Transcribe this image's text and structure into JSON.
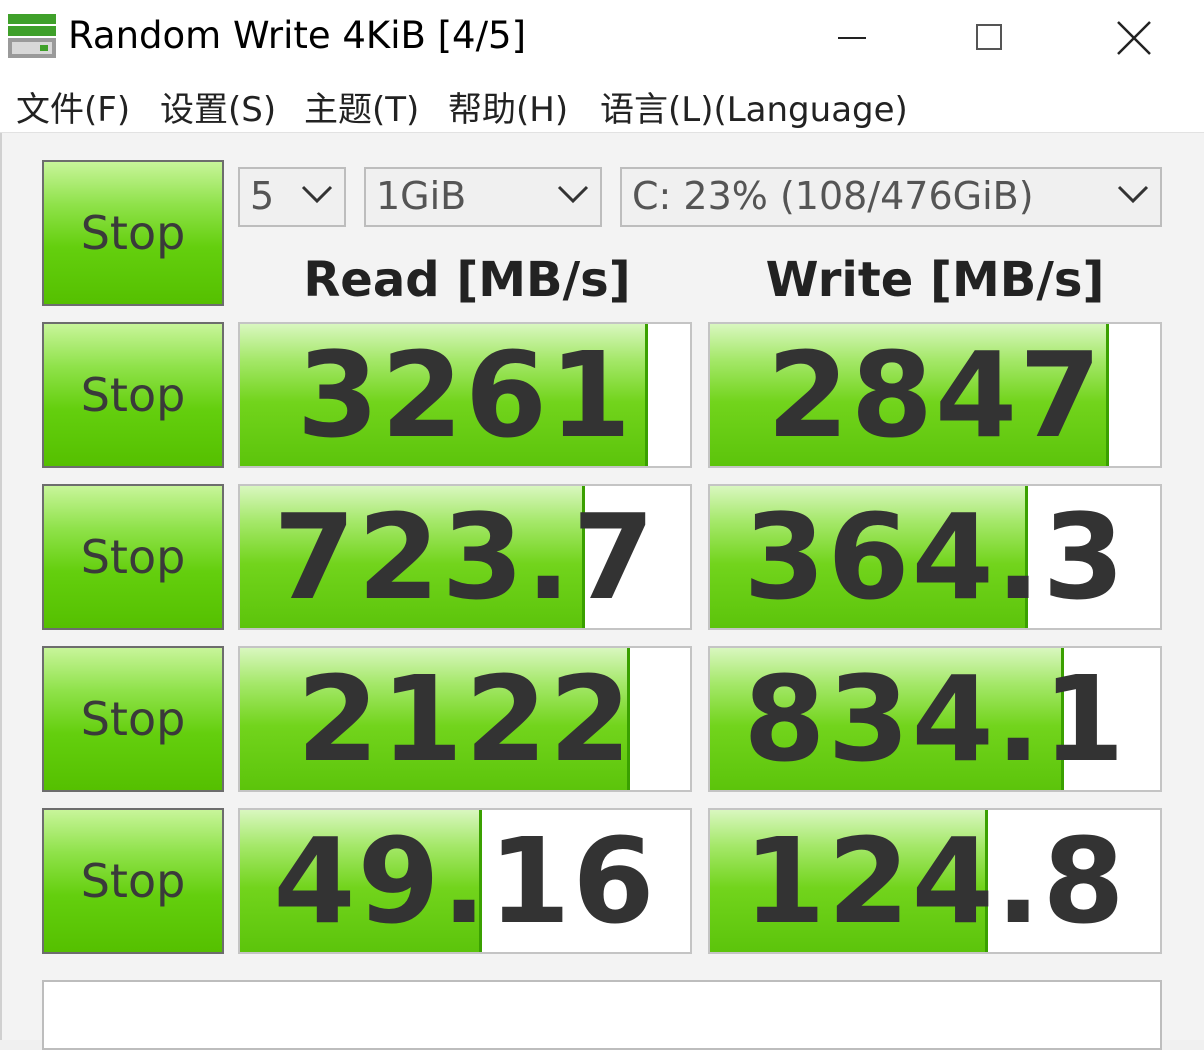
{
  "window": {
    "title": "Random Write 4KiB [4/5]"
  },
  "menu": [
    {
      "label": "文件(F)"
    },
    {
      "label": "设置(S)"
    },
    {
      "label": "主题(T)"
    },
    {
      "label": "帮助(H)"
    },
    {
      "label": "语言(L)(Language)"
    }
  ],
  "controls": {
    "all_button": "Stop",
    "count": "5",
    "size": "1GiB",
    "drive": "C: 23% (108/476GiB)"
  },
  "headers": {
    "read": "Read [MB/s]",
    "write": "Write [MB/s]"
  },
  "rows": [
    {
      "button": "Stop",
      "read": "3261",
      "read_fill": 0.9,
      "write": "2847",
      "write_fill": 0.88
    },
    {
      "button": "Stop",
      "read": "723.7",
      "read_fill": 0.76,
      "write": "364.3",
      "write_fill": 0.7
    },
    {
      "button": "Stop",
      "read": "2122",
      "read_fill": 0.86,
      "write": "834.1",
      "write_fill": 0.78
    },
    {
      "button": "Stop",
      "read": "49.16",
      "read_fill": 0.53,
      "write": "124.8",
      "write_fill": 0.61
    }
  ],
  "colors": {
    "accent": "#5cc40b",
    "border": "#6d6d6d"
  },
  "icons": [
    "app-drive-icon",
    "minimize-icon",
    "maximize-icon",
    "close-icon",
    "chevron-down-icon"
  ]
}
